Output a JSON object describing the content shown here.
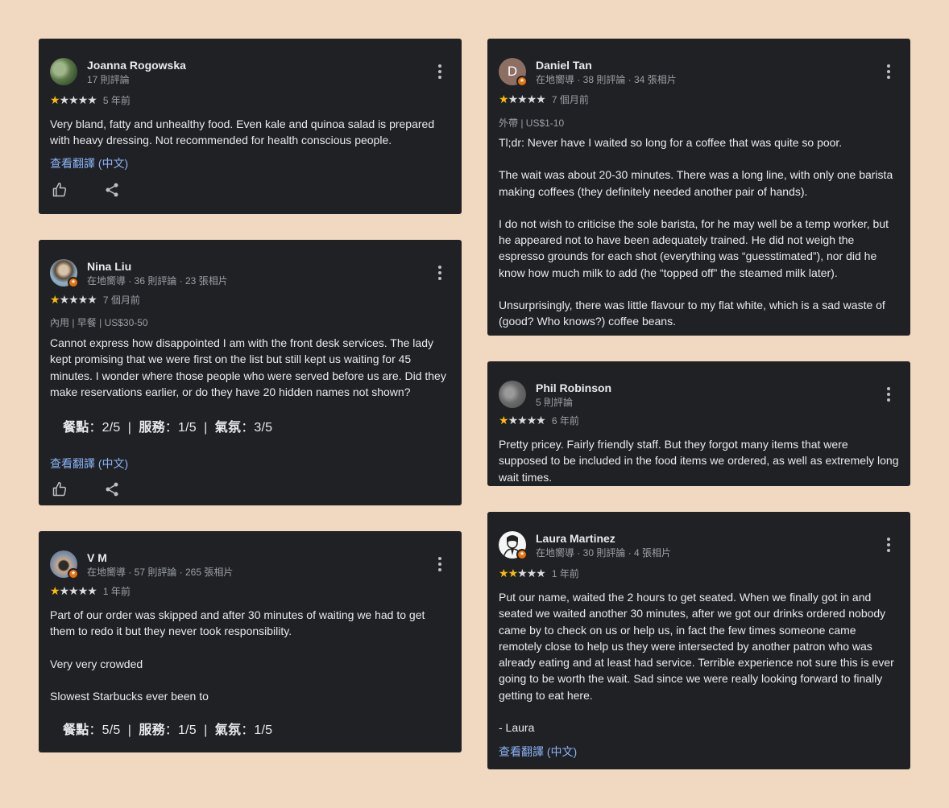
{
  "colors": {
    "background": "#f0d9c0",
    "card": "#202124",
    "star": "#fbbc04",
    "link": "#8ab4f8",
    "badge": "#e8710a"
  },
  "reviews": [
    {
      "name": "Joanna Rogowska",
      "meta": "17 則評論",
      "stars": 1,
      "ago": "5 年前",
      "text": [
        "Very bland, fatty and unhealthy food. Even kale and quinoa salad is prepared with heavy dressing. Not recommended for health conscious people."
      ],
      "translate": "查看翻譯 (中文)",
      "avatar_icon": "plant-photo-avatar"
    },
    {
      "name": "Nina Liu",
      "meta": "在地嚮導 · 36 則評論 · 23 張相片",
      "stars": 1,
      "ago": "7 個月前",
      "tags": "內用 | 早餐 | US$30-50",
      "text": [
        "Cannot express how disappointed I am with the front desk services. The lady kept promising that we were first on the list but still kept us waiting for 45 minutes. I wonder where those people who were served before us are. Did they make reservations earlier, or do they have 20 hidden names not shown?"
      ],
      "scores": {
        "food_label": "餐點",
        "food": "2/5",
        "service_label": "服務",
        "service": "1/5",
        "atmosphere_label": "氣氛",
        "atmosphere": "3/5"
      },
      "translate": "查看翻譯 (中文)"
    },
    {
      "name": "V M",
      "meta": "在地嚮導 · 57 則評論 · 265 張相片",
      "stars": 1,
      "ago": "1 年前",
      "text": [
        "Part of our order was skipped and after 30 minutes of waiting we had to get them to redo it but they never took responsibility.",
        "Very very crowded",
        "Slowest Starbucks ever been to"
      ],
      "scores": {
        "food_label": "餐點",
        "food": "5/5",
        "service_label": "服務",
        "service": "1/5",
        "atmosphere_label": "氣氛",
        "atmosphere": "1/5"
      }
    },
    {
      "name": "Daniel Tan",
      "meta": "在地嚮導 · 38 則評論 · 34 張相片",
      "avatar_letter": "D",
      "stars": 1,
      "ago": "7 個月前",
      "tags": "外帶 | US$1-10",
      "text": [
        "Tl;dr: Never have I waited so long for a coffee that was quite so poor.",
        "The wait was about 20-30 minutes. There was a long line, with only one barista making coffees (they definitely needed another pair of hands).",
        "I do not wish to criticise the sole barista, for he may well be a temp worker, but he appeared not to have been adequately trained. He did not weigh the espresso grounds for each shot (everything was “guesstimated”), nor did he know how much milk to add (he “topped off” the steamed milk later).",
        "Unsurprisingly, there was little flavour to my flat white, which is a sad waste of (good? Who knows?) coffee beans."
      ]
    },
    {
      "name": "Phil Robinson",
      "meta": "5 則評論",
      "stars": 1,
      "ago": "6 年前",
      "text": [
        "Pretty pricey. Fairly friendly staff. But they forgot many items that were supposed to be included in the food items we ordered, as well as extremely long wait times."
      ]
    },
    {
      "name": "Laura Martinez",
      "meta": "在地嚮導 · 30 則評論 · 4 張相片",
      "stars": 2,
      "ago": "1 年前",
      "text": [
        "Put our name, waited the 2 hours to get seated. When we finally got in and seated we waited another 30 minutes, after we got our drinks ordered nobody came by to check on us or help us, in fact the few times someone came remotely close to help us they were intersected by another patron who was already eating and at least had service. Terrible experience not sure this is ever going to be worth the wait. Sad since we were really looking forward to finally getting to eat here.",
        "- Laura"
      ],
      "translate": "查看翻譯 (中文)"
    }
  ]
}
